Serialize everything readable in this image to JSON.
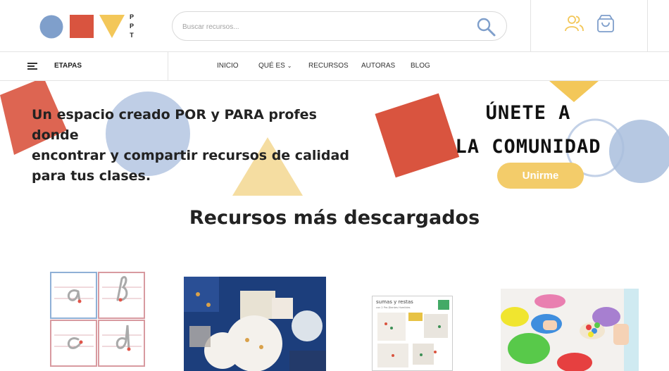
{
  "header": {
    "logo_letters": "PPT",
    "search": {
      "placeholder": "Buscar recursos..."
    },
    "icons": [
      "user-group-icon",
      "shopping-bag-icon"
    ],
    "accent_color": "#f3cc6a"
  },
  "nav": {
    "stages_label": "ETAPAS",
    "items": [
      {
        "label": "INICIO"
      },
      {
        "label": "QUÉ ES",
        "has_dropdown": true
      },
      {
        "label": "RECURSOS"
      },
      {
        "label": "AUTORAS"
      },
      {
        "label": "BLOG"
      }
    ]
  },
  "banner": {
    "tagline_lines": [
      "Un espacio creado POR y PARA profes donde",
      "encontrar y compartir recursos de calidad",
      "para tus clases."
    ],
    "cta_lines": [
      "ÚNETE A",
      "LA COMUNIDAD PPT"
    ],
    "join_label": "Unirme"
  },
  "section": {
    "title": "Recursos más descargados"
  },
  "resources": {
    "card3_title": "sumas y restas",
    "card3_subtitle": "con 2 Pre-Dientes Humildes"
  }
}
